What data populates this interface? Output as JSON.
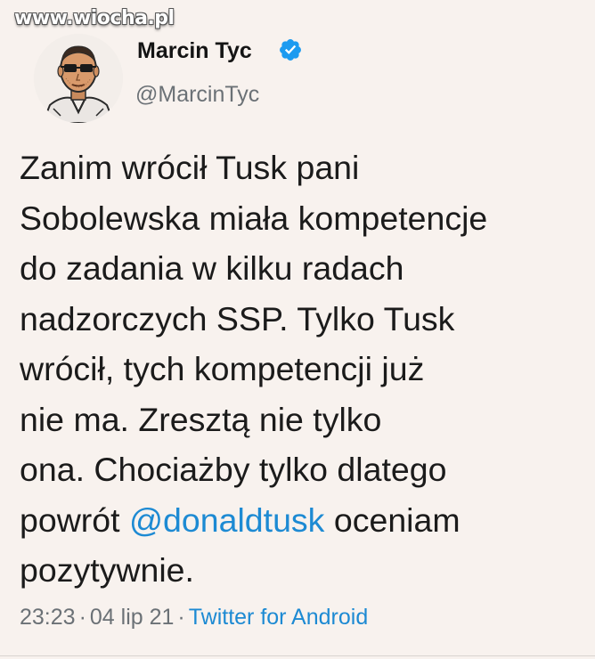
{
  "watermark": "www.wiocha.pl",
  "author": {
    "name": "Marcin Tyc",
    "handle": "@MarcinTyc",
    "verified": true
  },
  "tweet": {
    "lines": [
      "Zanim wrócił Tusk pani",
      "Sobolewska miała kompetencje",
      "do zadania w kilku radach",
      "nadzorczych SSP. Tylko Tusk",
      "wrócił, tych kompetencji już",
      "nie ma. Zresztą nie tylko",
      "ona. Chociażby tylko dlatego"
    ],
    "line8_before": "powrót ",
    "mention": "@donaldtusk",
    "line8_after": " oceniam",
    "last_line": "pozytywnie."
  },
  "meta": {
    "time": "23:23",
    "separator": "·",
    "date": "04 lip 21",
    "source": "Twitter for Android"
  },
  "colors": {
    "background": "#f8f2ee",
    "link": "#1d8ad3",
    "muted": "#6b7176",
    "verified": "#1d9bf0"
  }
}
